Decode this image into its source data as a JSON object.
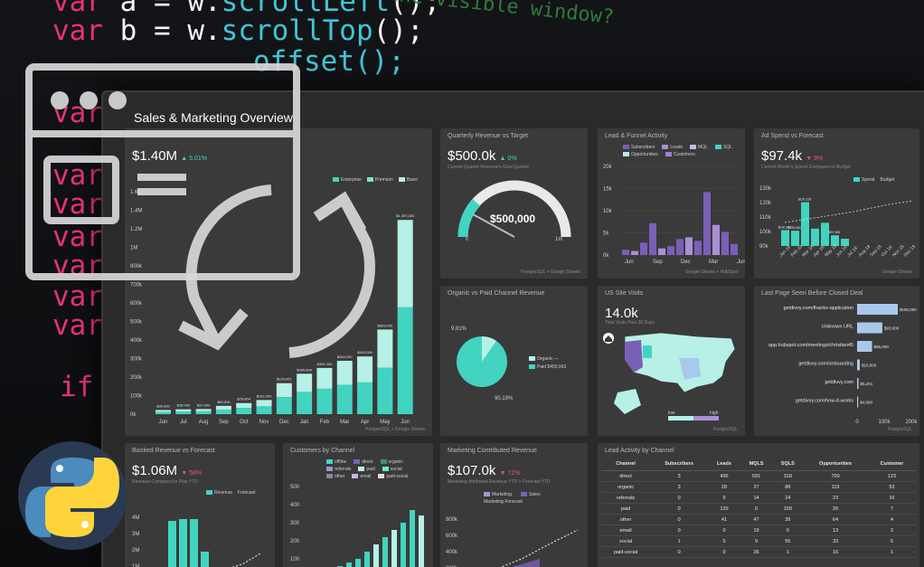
{
  "code": {
    "lines": [
      {
        "kw": "var",
        "rest": "a = w.",
        "fn": "scrollLeft",
        "tail": "();"
      },
      {
        "kw": "var",
        "rest": "b = w.",
        "fn": "scrollTop",
        "tail": "();"
      },
      {
        "kw": "var",
        "rest": "",
        "fn": "",
        "tail": ""
      },
      {
        "kw": "var",
        "rest": "",
        "fn": "",
        "tail": ""
      },
      {
        "kw": "var",
        "rest": "",
        "fn": "",
        "tail": ""
      },
      {
        "kw": "var",
        "rest": "",
        "fn": "",
        "tail": ""
      },
      {
        "kw": "var",
        "rest": "",
        "fn": "",
        "tail": ""
      },
      {
        "kw": "var",
        "rest": "",
        "fn": "",
        "tail": ""
      },
      {
        "kw": "var",
        "rest": "",
        "fn": "",
        "tail": ""
      },
      {
        "kw": "var",
        "rest": "",
        "fn": "",
        "tail": ""
      },
      {
        "kw": "if",
        "rest": "",
        "fn": "",
        "tail": ""
      }
    ],
    "comment": "the visible window?",
    "partial": "offset();"
  },
  "dashboard": {
    "title": "Sales & Marketing Overview",
    "colors": {
      "teal": "#42d4c0",
      "mint": "#b6f0e6",
      "purple": "#7a5fb8",
      "lavender": "#a98fd6",
      "blue": "#a9c9ea"
    },
    "sales": {
      "value": "$1.40M",
      "delta": "▲ 5.01%",
      "legend": [
        "Enterprise",
        "Premium",
        "Basic"
      ],
      "yticks": [
        "1.6M",
        "1.4M",
        "1.2M",
        "1M",
        "800k",
        "700k",
        "600k",
        "500k",
        "400k",
        "300k",
        "200k",
        "100k",
        "0k"
      ],
      "months": [
        "Jun",
        "Jul",
        "Aug",
        "Sep",
        "Oct",
        "Nov",
        "Dec",
        "Jan",
        "Feb",
        "Mar",
        "Apr",
        "May",
        "Jun"
      ],
      "labels": [
        "$30,000",
        "$35,000",
        "$37,000",
        "$60,000",
        "$79,804",
        "$102,000",
        "$223,001",
        "$290,800",
        "$332,400",
        "$384,000",
        "$415,000",
        "$609,000",
        "$1,397,000"
      ],
      "values": [
        30000,
        35000,
        37000,
        60000,
        79804,
        102000,
        223001,
        290800,
        332400,
        384000,
        415000,
        609000,
        1397000
      ],
      "footer": "PostgreSQL + Google Sheets"
    },
    "quarterly": {
      "title": "Quarterly Revenue vs Target",
      "value": "$500.0k",
      "delta": "▲ 0%",
      "sub": "Current Quarter Revenue's Goal Quarter",
      "gauge_value": "$500,000",
      "min": "0",
      "max": "1m",
      "fraction": 0.5,
      "footer": "PostgreSQL + Google Sheets"
    },
    "funnel": {
      "title": "Lead & Funnel Activity",
      "legend": [
        "Subscribers",
        "Leads",
        "MQL",
        "SQL",
        "Opportunities",
        "Customers"
      ],
      "yticks": [
        "20k",
        "15k",
        "10k",
        "5k",
        "0k"
      ],
      "months": [
        "Jun",
        "Sep",
        "Dec",
        "Mar",
        "Jun"
      ],
      "values": [
        1200,
        900,
        2800,
        7200,
        1500,
        2000,
        3600,
        4000,
        3200,
        14200,
        6800,
        5200,
        2500
      ],
      "footer": "Google Sheets + HubSpot"
    },
    "adspend": {
      "title": "Ad Spend vs Forecast",
      "value": "$97.4k",
      "delta": "▼ 9%",
      "sub": "Current Month's Spend Compared to Budget",
      "legend": [
        "Spend",
        "Budget"
      ],
      "yticks": [
        "130k",
        "120k",
        "110k",
        "100k",
        "90k"
      ],
      "months": [
        "Jan 18",
        "Feb 18",
        "Mar 18",
        "Apr 18",
        "May 18",
        "Jun 18",
        "Jul 18",
        "Aug 18",
        "Sep 18",
        "Oct 18",
        "Nov 18",
        "Dec 18"
      ],
      "values": [
        100987,
        100540,
        120218,
        102000,
        106000,
        97369,
        95000
      ],
      "labels": [
        "$100,987",
        "$100,540",
        "$120,218",
        "",
        "",
        "$97,369",
        ""
      ],
      "footer": "Google Sheets"
    },
    "organic": {
      "title": "Organic vs Paid Channel Revenue",
      "pct_small": "9.81%",
      "pct_big": "90.19%",
      "legend": [
        "Organic",
        "Paid"
      ],
      "legend_values": [
        "—",
        "$450,963"
      ],
      "fraction": 0.9019
    },
    "us": {
      "title": "US Site Visits",
      "value": "14.0k",
      "sub": "Total Visits Past 30 Days",
      "low": "low",
      "high": "high",
      "footer": "PostgreSQL"
    },
    "lastpage": {
      "title": "Last Page Seen Before Closed Deal",
      "rows": [
        {
          "url": "getdivvy.com/thanks-application",
          "label": "$150,000",
          "value": 150000
        },
        {
          "url": "Unknown URL",
          "label": "$93,000",
          "value": 93000
        },
        {
          "url": "app.hubspot.com/meetings/christian45",
          "label": "$55,000",
          "value": 55000
        },
        {
          "url": "getdivvy.com/onboarding",
          "label": "$10,000",
          "value": 10000
        },
        {
          "url": "getdivvy.com",
          "label": "$5,201",
          "value": 5201
        },
        {
          "url": "getdivvy.com/how-it-works",
          "label": "$4,000",
          "value": 4000
        }
      ],
      "xticks": [
        "0",
        "100k",
        "200k"
      ],
      "footer": "PostgreSQL"
    },
    "booked": {
      "title": "Booked Revenue vs Forecast",
      "value": "$1.06M",
      "delta": "▼ 58%",
      "sub": "Revenue Compared to Plan YTD",
      "legend": [
        "Revenue",
        "Forecast"
      ],
      "yticks": [
        "4M",
        "3M",
        "2M",
        "1M"
      ]
    },
    "customers": {
      "title": "Customers by Channel",
      "legend": [
        "offline",
        "direct",
        "organic",
        "referrals",
        "paid",
        "social",
        "other",
        "email",
        "paid-social"
      ],
      "yticks": [
        "500",
        "400",
        "300",
        "200",
        "100"
      ]
    },
    "marketing": {
      "title": "Marketing Contributed Revenue",
      "value": "$107.0k",
      "delta": "▼ 72%",
      "sub": "Marketing Attributed Revenue YTD + Forecast YTD",
      "legend": [
        "Marketing",
        "Sales",
        "Marketing Forecast"
      ],
      "yticks": [
        "800k",
        "600k",
        "400k",
        "200k"
      ]
    },
    "leadchannel": {
      "title": "Lead Activity by Channel",
      "headers": [
        "Channel",
        "Subscribers",
        "Leads",
        "MQLS",
        "SQLS",
        "Opportunities",
        "Customer"
      ],
      "rows": [
        [
          "direct",
          "3",
          "496",
          "591",
          "318",
          "700",
          "123"
        ],
        [
          "organic",
          "3",
          "28",
          "27",
          "88",
          "119",
          "53"
        ],
        [
          "referrals",
          "0",
          "9",
          "14",
          "24",
          "23",
          "16"
        ],
        [
          "paid",
          "0",
          "120",
          "0",
          "159",
          "26",
          "7"
        ],
        [
          "other",
          "0",
          "41",
          "47",
          "39",
          "64",
          "4"
        ],
        [
          "email",
          "0",
          "0",
          "19",
          "0",
          "13",
          "3"
        ],
        [
          "social",
          "1",
          "5",
          "9",
          "55",
          "33",
          "5"
        ],
        [
          "paid-social",
          "0",
          "0",
          "36",
          "1",
          "16",
          "1"
        ]
      ]
    }
  }
}
